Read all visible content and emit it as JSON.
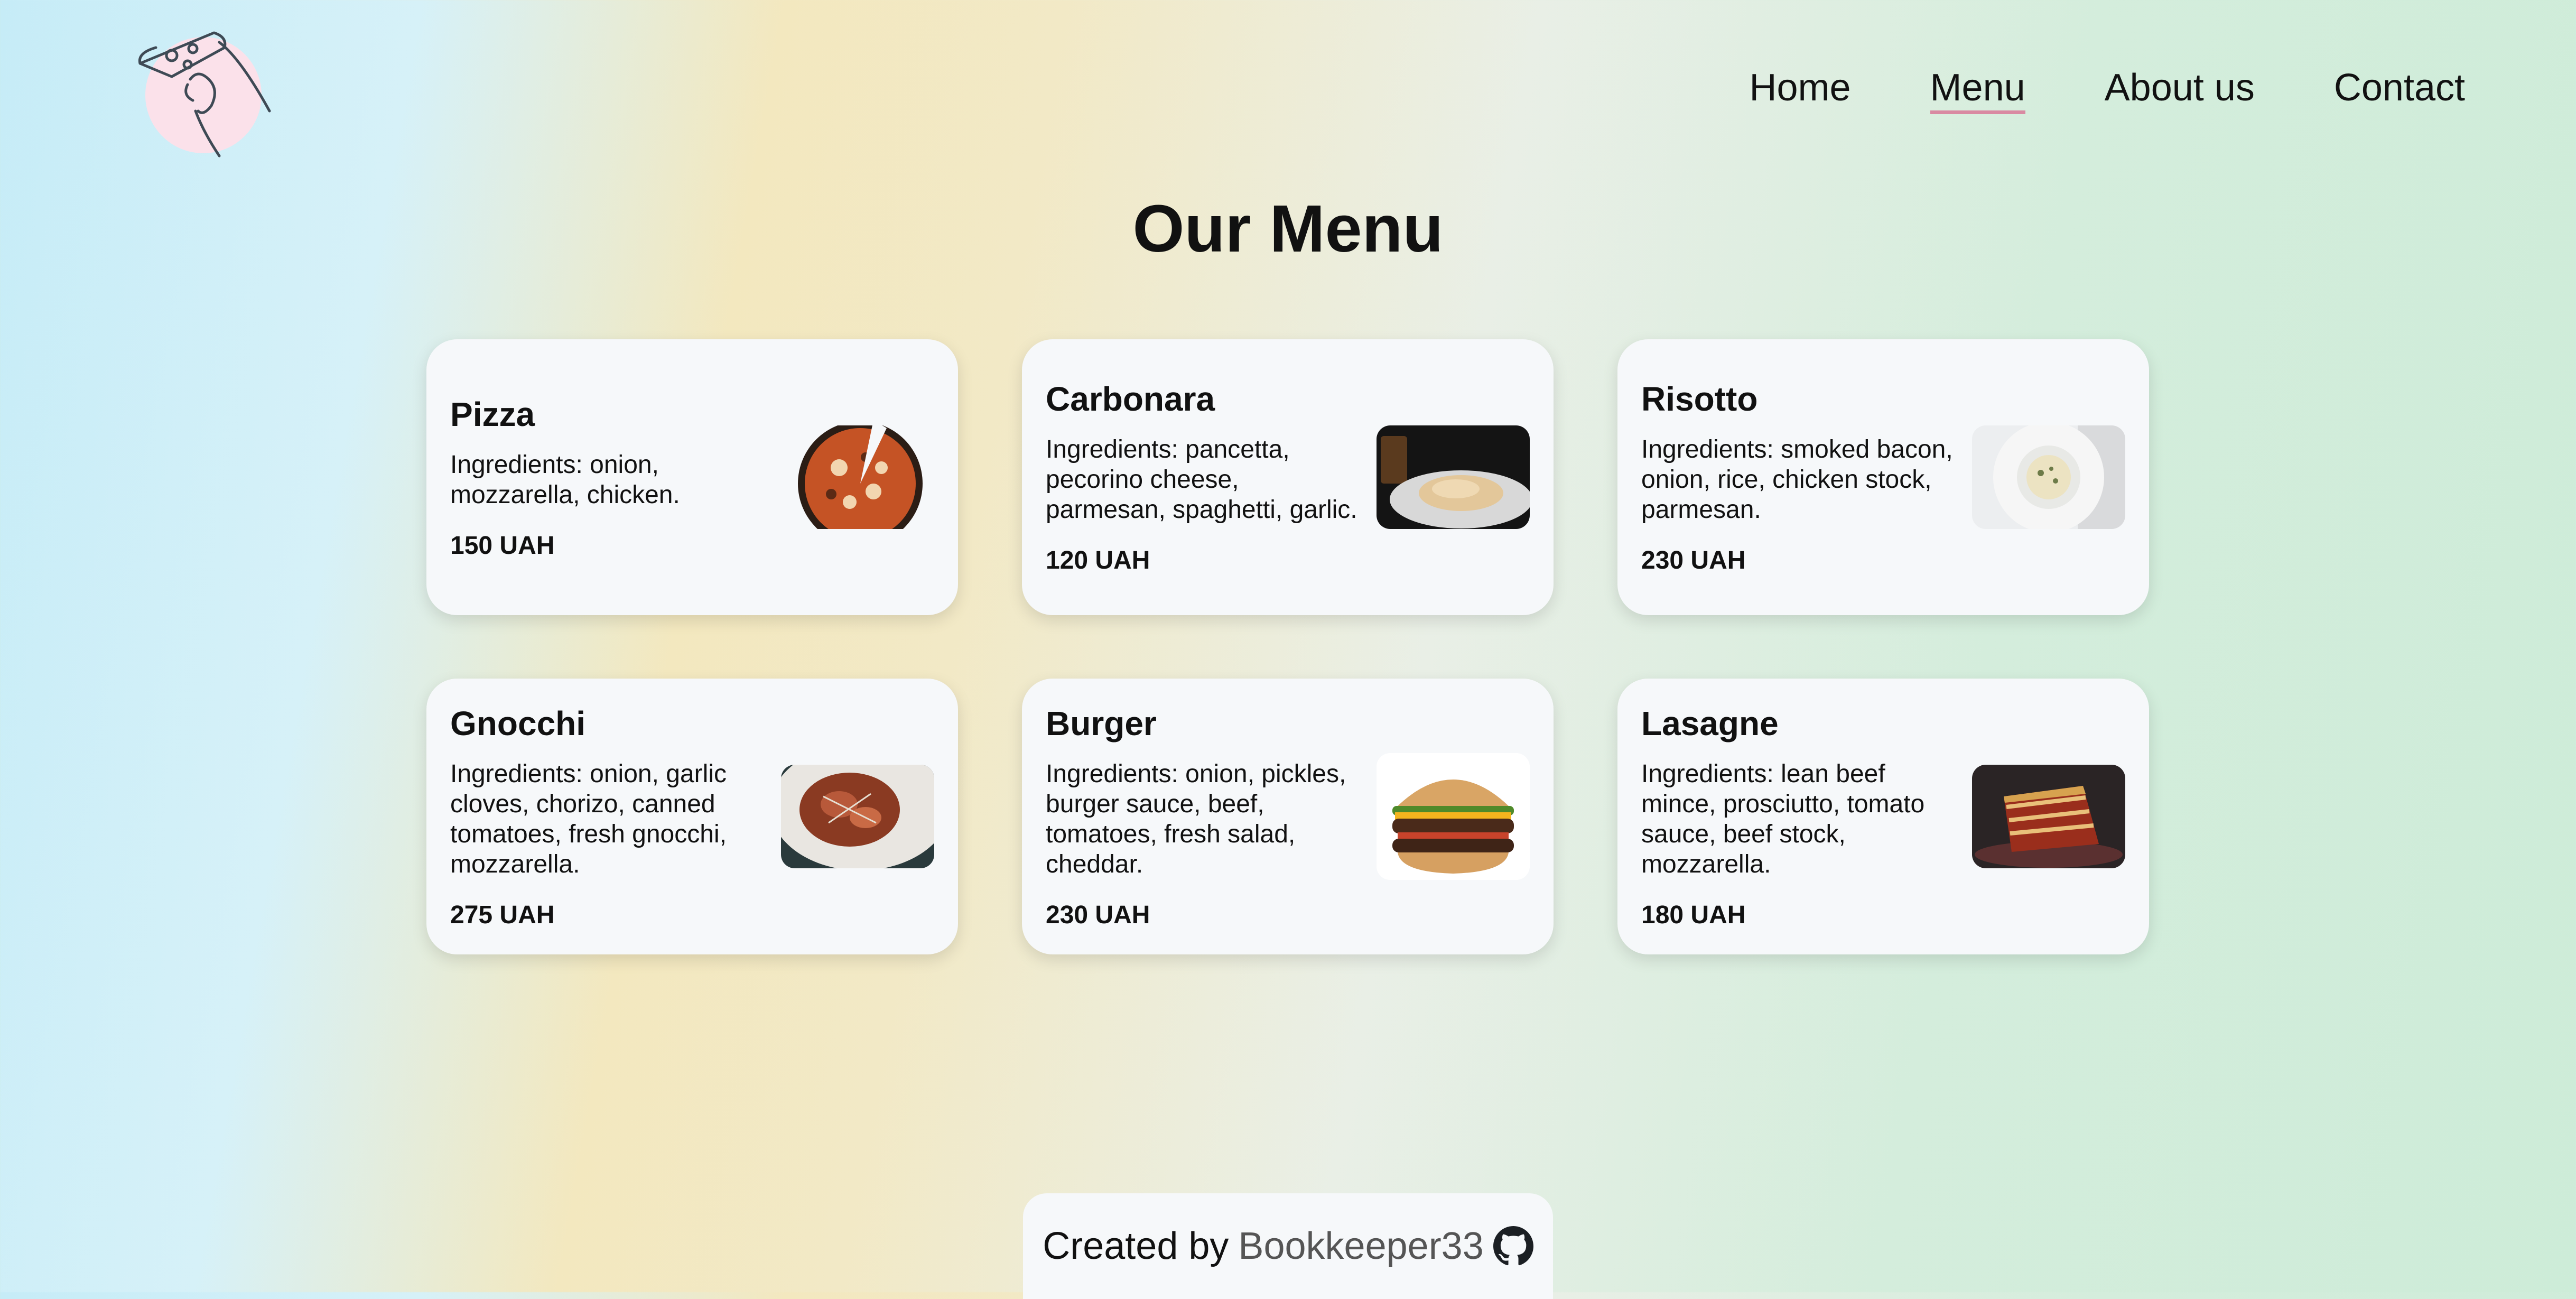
{
  "nav": {
    "items": [
      {
        "label": "Home"
      },
      {
        "label": "Menu"
      },
      {
        "label": "About us"
      },
      {
        "label": "Contact"
      }
    ],
    "active": "Menu"
  },
  "page_title": "Our Menu",
  "menu_items": [
    {
      "name": "Pizza",
      "ingredients": "Ingredients: onion, mozzarella, chicken.",
      "price": "150 UAH",
      "image_icon": "pizza-image"
    },
    {
      "name": "Carbonara",
      "ingredients": "Ingredients: pancetta, pecorino cheese, parmesan, spaghetti, garlic.",
      "price": "120 UAH",
      "image_icon": "carbonara-image"
    },
    {
      "name": "Risotto",
      "ingredients": "Ingredients: smoked bacon, onion, rice, chicken stock, parmesan.",
      "price": "230 UAH",
      "image_icon": "risotto-image"
    },
    {
      "name": "Gnocchi",
      "ingredients": "Ingredients: onion, garlic cloves, chorizo, canned tomatoes, fresh gnocchi, mozzarella.",
      "price": "275 UAH",
      "image_icon": "gnocchi-image"
    },
    {
      "name": "Burger",
      "ingredients": "Ingredients: onion, pickles, burger sauce, beef, tomatoes, fresh salad, cheddar.",
      "price": "230 UAH",
      "image_icon": "burger-image"
    },
    {
      "name": "Lasagne",
      "ingredients": "Ingredients: lean beef mince, prosciutto, tomato sauce, beef stock, mozzarella.",
      "price": "180 UAH",
      "image_icon": "lasagne-image"
    }
  ],
  "footer": {
    "lead": "Created by",
    "author": "Bookkeeper33",
    "icon": "github-icon"
  },
  "colors": {
    "active_underline": "#d98aa2",
    "card_bg": "#f6f8fa",
    "logo_circle": "#fbe1ea"
  }
}
